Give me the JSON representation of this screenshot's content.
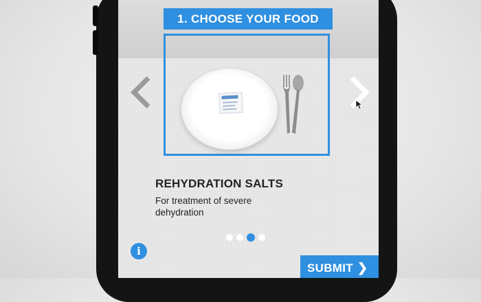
{
  "app": {
    "step_title": "1. CHOOSE YOUR FOOD",
    "food": {
      "name": "REHYDRATION SALTS",
      "description": "For treatment of severe dehydration"
    },
    "pagination": {
      "total": 4,
      "active_index": 2
    },
    "icons": {
      "previous": "chevron-left-icon",
      "next": "chevron-right-icon",
      "info": "info-icon",
      "submit_arrow": "chevron-right-icon"
    },
    "info_glyph": "i",
    "submit_label": "SUBMIT",
    "submit_chevron": "❯",
    "colors": {
      "accent": "#2f8fe0",
      "text": "#222222",
      "arrow_inactive": "#9a9a9a"
    }
  }
}
